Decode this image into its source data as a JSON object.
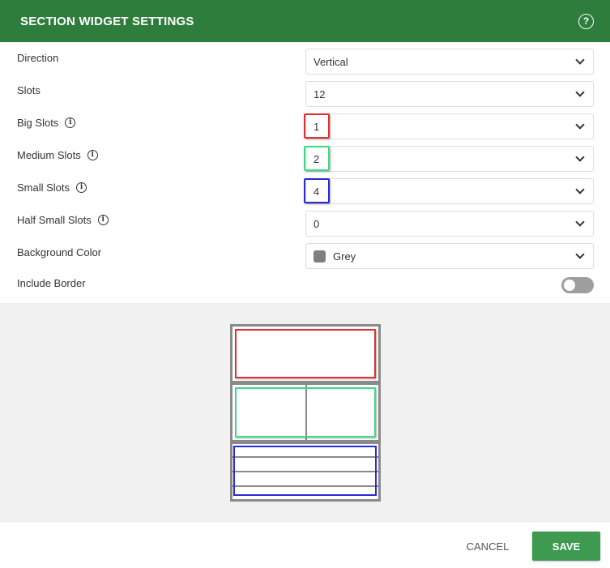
{
  "header": {
    "title": "SECTION WIDGET SETTINGS",
    "help_icon": "question-circle-icon"
  },
  "form": {
    "direction": {
      "label": "Direction",
      "value": "Vertical"
    },
    "slots": {
      "label": "Slots",
      "value": "12"
    },
    "big_slots": {
      "label": "Big Slots",
      "value": "1",
      "highlight": "#e03030"
    },
    "medium_slots": {
      "label": "Medium Slots",
      "value": "2",
      "highlight": "#3ddc84"
    },
    "small_slots": {
      "label": "Small Slots",
      "value": "4",
      "highlight": "#2a2ad8"
    },
    "half_small_slots": {
      "label": "Half Small Slots",
      "value": "0"
    },
    "background_color": {
      "label": "Background Color",
      "value": "Grey",
      "swatch": "#808080"
    },
    "include_border": {
      "label": "Include Border",
      "enabled": false
    }
  },
  "footer": {
    "cancel_label": "CANCEL",
    "save_label": "SAVE"
  },
  "colors": {
    "header": "#2e7d3c",
    "save": "#3d9a50",
    "preview_bg": "#f1f1f1"
  }
}
